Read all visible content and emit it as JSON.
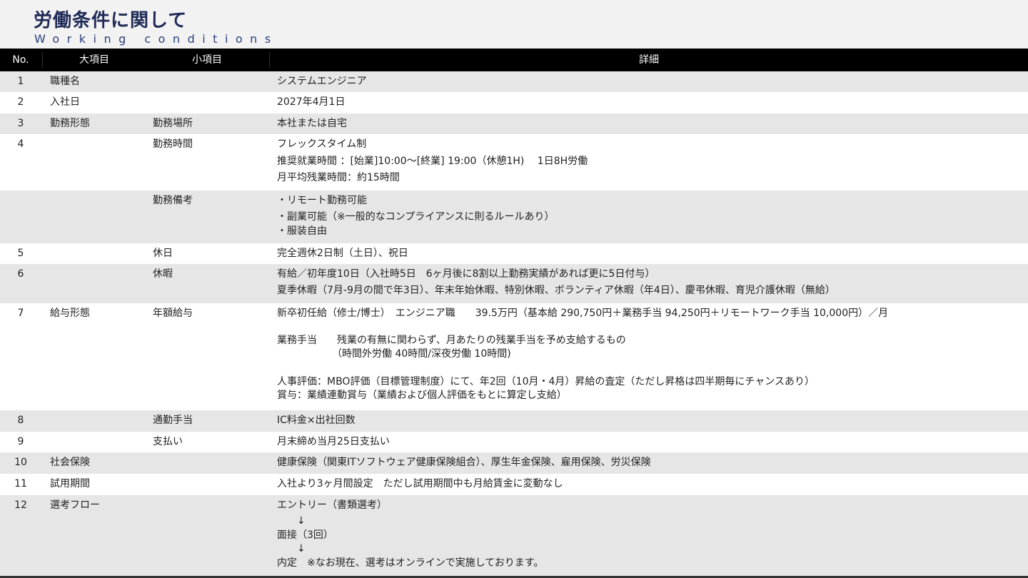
{
  "header": {
    "title": "労働条件に関して",
    "subtitle": "Working conditions"
  },
  "table": {
    "columns": [
      "No.",
      "大項目",
      "小項目",
      "詳細"
    ],
    "rows": [
      {
        "no": "1",
        "major": "職種名",
        "minor": "",
        "details": [
          "システムエンジニア"
        ]
      },
      {
        "no": "2",
        "major": "入社日",
        "minor": "",
        "details": [
          "2027年4月1日"
        ]
      },
      {
        "no": "3",
        "major": "勤務形態",
        "minor": "勤務場所",
        "details": [
          "本社または自宅"
        ]
      },
      {
        "no": "4",
        "major": "",
        "minor": "勤務時間",
        "details": [
          "フレックスタイム制",
          "推奨就業時間 ：[始業]10:00～[終業] 19:00（休憩1H)　 1日8H労働",
          "月平均残業時間：約15時間"
        ]
      },
      {
        "no": "",
        "major": "",
        "minor": "勤務備考",
        "details": [
          "・リモート勤務可能",
          "・副業可能（※一般的なコンプライアンスに則るルールあり）",
          "・服装自由"
        ]
      },
      {
        "no": "5",
        "major": "",
        "minor": "休日",
        "details": [
          "完全週休2日制（土日）、祝日"
        ]
      },
      {
        "no": "6",
        "major": "",
        "minor": "休暇",
        "details": [
          "有給／初年度10日（入社時5日　6ヶ月後に8割以上勤務実績があれば更に5日付与）",
          "夏季休暇（7月-9月の間で年3日）、年末年始休暇、特別休暇、ボランティア休暇（年4日）、慶弔休暇、育児介護休暇（無給）"
        ]
      },
      {
        "no": "7",
        "major": "給与形態",
        "minor": "年額給与",
        "details": [
          "新卒初任給（修士/博士）　エンジニア職　　39.5万円（基本給 290,750円＋業務手当 94,250円＋リモートワーク手当 10,000円）／月",
          "業務手当　　残業の有無に関わらず、月あたりの残業手当を予め支給するもの",
          "　　　　　　（時間外労働 40時間/深夜労働 10時間)",
          "人事評価：MBO評価（目標管理制度）にて、年2回（10月・4月）昇給の査定（ただし昇格は四半期毎にチャンスあり）",
          "賞与：業績連動賞与（業績および個人評価をもとに算定し支給）"
        ]
      },
      {
        "no": "8",
        "major": "",
        "minor": "通勤手当",
        "details": [
          "IC料金×出社回数"
        ]
      },
      {
        "no": "9",
        "major": "",
        "minor": "支払い",
        "details": [
          "月末締め当月25日支払い"
        ]
      },
      {
        "no": "10",
        "major": "社会保険",
        "minor": "",
        "details": [
          "健康保険（関東ITソフトウェア健康保険組合）、厚生年金保険、雇用保険、労災保険"
        ]
      },
      {
        "no": "11",
        "major": "試用期間",
        "minor": "",
        "details": [
          "入社より3ヶ月間設定　ただし試用期間中も月給賃金に変動なし"
        ]
      },
      {
        "no": "12",
        "major": "選考フロー",
        "minor": "",
        "details": [
          "エントリー（書類選考）",
          "　　↓",
          "面接（3回）",
          "　　↓",
          "内定　※なお現在、選考はオンラインで実施しております。"
        ]
      }
    ]
  }
}
